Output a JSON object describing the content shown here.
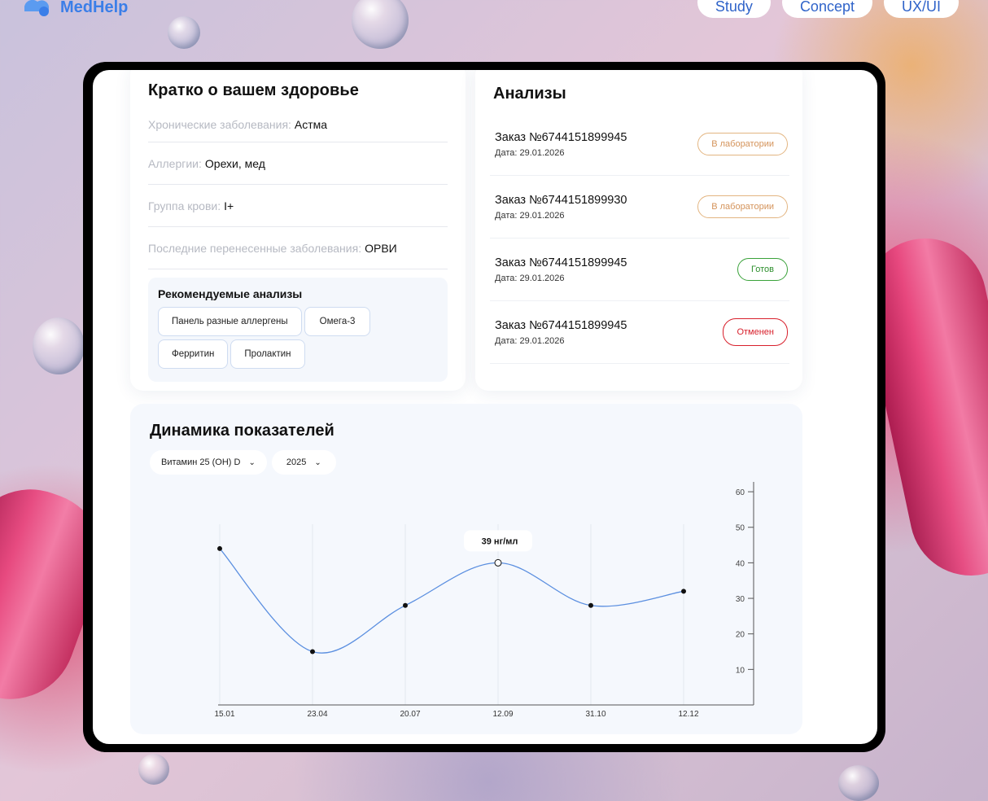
{
  "brand": {
    "name": "MedHelp"
  },
  "nav": [
    {
      "label": "Study"
    },
    {
      "label": "Concept"
    },
    {
      "label": "UX/UI"
    }
  ],
  "health": {
    "title": "Кратко о вашем здоровье",
    "rows": [
      {
        "label": "Хронические заболевания:",
        "value": "Астма"
      },
      {
        "label": "Аллергии:",
        "value": "Орехи, мед"
      },
      {
        "label": "Группа крови:",
        "value": "I+"
      },
      {
        "label": "Последние перенесенные заболевания:",
        "value": "ОРВИ"
      }
    ],
    "recommended": {
      "title": "Рекомендуемые анализы",
      "chips": [
        "Панель разные аллергены",
        "Омега-3",
        "Ферритин",
        "Пролактин"
      ]
    }
  },
  "analyses": {
    "title": "Анализы",
    "items": [
      {
        "name": "Заказ №6744151899945",
        "date": "Дата: 29.01.2026",
        "status": "В лаборатории"
      },
      {
        "name": "Заказ №6744151899930",
        "date": "Дата: 29.01.2026",
        "status": "В лаборатории"
      },
      {
        "name": "Заказ №6744151899945",
        "date": "Дата: 29.01.2026",
        "status": "Готов"
      },
      {
        "name": "Заказ №6744151899945",
        "date": "Дата: 29.01.2026",
        "status": "Отменен"
      }
    ],
    "status_colors": {
      "lab": "#d4935a",
      "ready": "#2d8f2d",
      "cancel": "#d8202c"
    }
  },
  "dynamics": {
    "title": "Динамика показателей",
    "indicator_select": "Витамин 25 (ОН) D",
    "year_select": "2025",
    "tooltip": "39 нг/мл"
  },
  "chart_data": {
    "type": "line",
    "x": [
      "15.01",
      "23.04",
      "20.07",
      "12.09",
      "31.10",
      "12.12"
    ],
    "values": [
      44,
      15,
      28,
      40,
      28,
      32
    ],
    "ylim": [
      0,
      63
    ],
    "yticks": [
      10,
      20,
      30,
      40,
      50,
      60
    ],
    "highlight_index": 3,
    "line_color": "#5b8fe0"
  }
}
